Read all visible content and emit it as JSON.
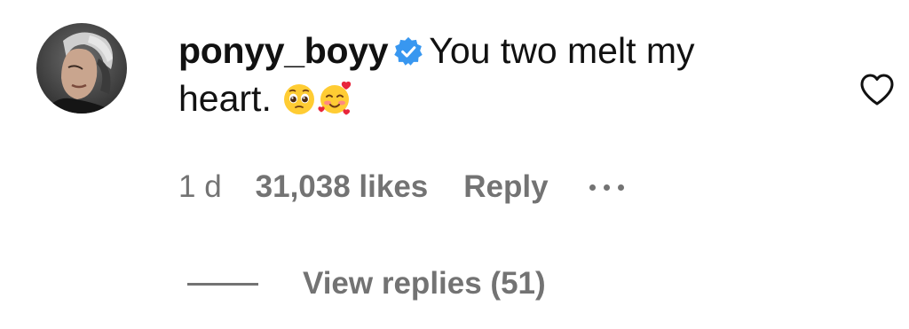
{
  "comment": {
    "username": "ponyy_boyy",
    "verified_icon": "verified-badge-icon",
    "text_line1": "You two melt my",
    "text_line2": "heart.",
    "emojis": [
      "pleading-face-emoji",
      "smiling-face-with-hearts-emoji"
    ]
  },
  "meta": {
    "time": "1 d",
    "likes": "31,038 likes",
    "reply_label": "Reply",
    "more_icon": "more-options-icon"
  },
  "view_replies": {
    "label": "View replies (51)"
  },
  "like_icon": "heart-outline-icon",
  "colors": {
    "text_primary": "#111111",
    "text_secondary": "#737373",
    "verified_blue": "#3897f0",
    "background": "#ffffff"
  }
}
